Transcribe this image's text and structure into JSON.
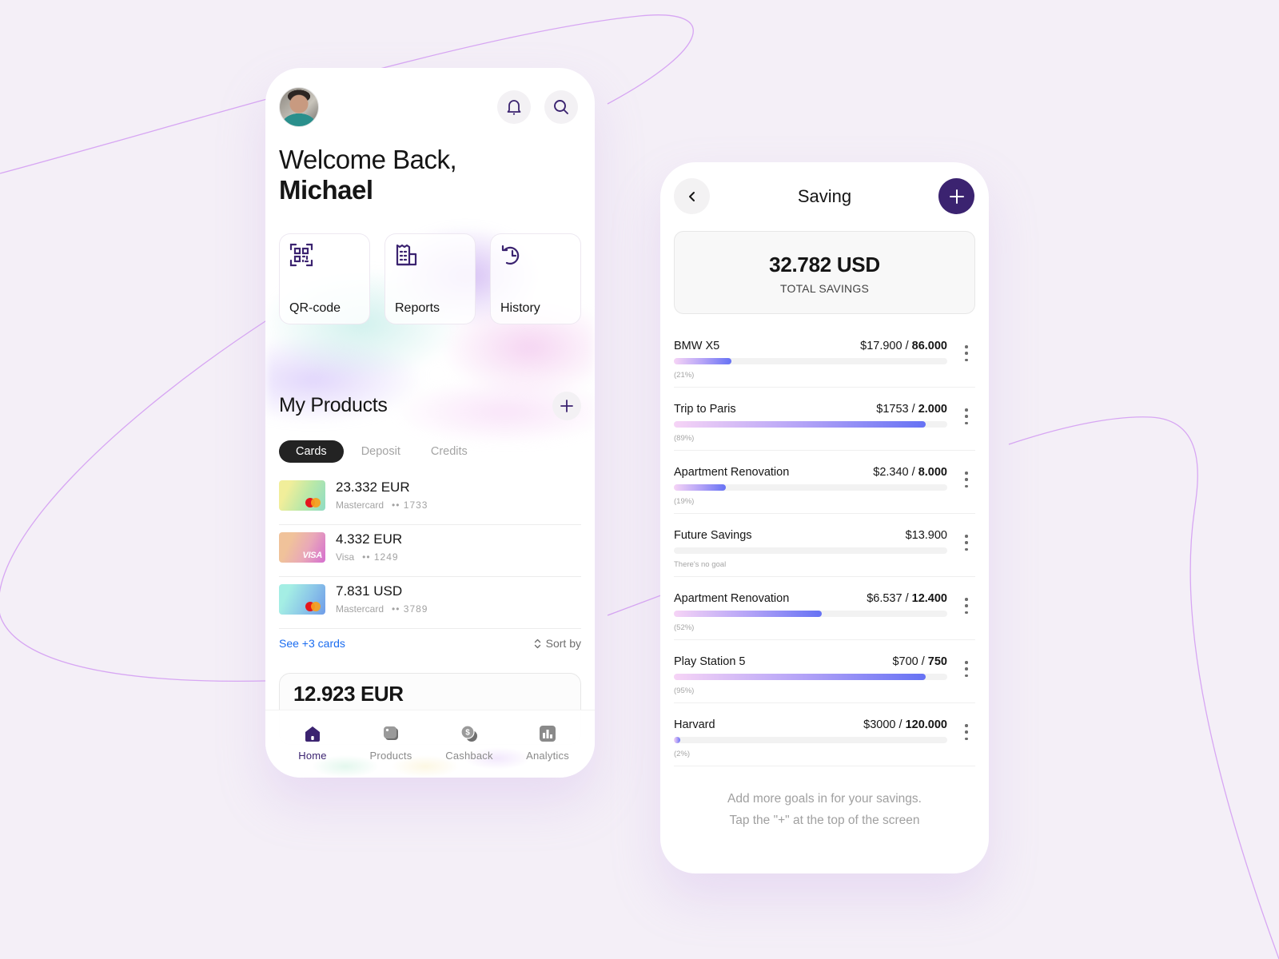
{
  "colors": {
    "background": "#f4eff7",
    "brand_purple": "#3b2370",
    "link_blue": "#1a6cf0",
    "progress_start": "#f6d4f6",
    "progress_end": "#6672f4"
  },
  "home": {
    "avatar_icon": "user-avatar-photo",
    "notifications_icon": "bell-icon",
    "search_icon": "search-icon",
    "welcome_line1": "Welcome Back,",
    "welcome_name": "Michael",
    "quick_actions": [
      {
        "label": "QR-code",
        "icon": "qr-code-icon"
      },
      {
        "label": "Reports",
        "icon": "receipt-icon"
      },
      {
        "label": "History",
        "icon": "history-icon"
      }
    ],
    "products": {
      "title": "My Products",
      "add_icon": "plus-icon",
      "tabs": [
        {
          "label": "Cards",
          "active": true
        },
        {
          "label": "Deposit",
          "active": false
        },
        {
          "label": "Credits",
          "active": false
        }
      ],
      "cards": [
        {
          "amount": "23.332 EUR",
          "brand": "Mastercard",
          "masked": "•• 1733",
          "logo": "mastercard-logo"
        },
        {
          "amount": "4.332 EUR",
          "brand": "Visa",
          "masked": "•• 1249",
          "logo": "visa-logo",
          "logo_text": "VISA"
        },
        {
          "amount": "7.831 USD",
          "brand": "Mastercard",
          "masked": "•• 3789",
          "logo": "mastercard-logo"
        }
      ],
      "see_more": "See +3 cards",
      "sort_by": "Sort by"
    },
    "balance_preview": "12.923 EUR",
    "nav": [
      {
        "label": "Home",
        "icon": "home-icon",
        "active": true
      },
      {
        "label": "Products",
        "icon": "cards-icon",
        "active": false
      },
      {
        "label": "Cashback",
        "icon": "coins-icon",
        "active": false
      },
      {
        "label": "Analytics",
        "icon": "chart-icon",
        "active": false
      }
    ]
  },
  "saving": {
    "title": "Saving",
    "back_icon": "chevron-left-icon",
    "add_icon": "plus-icon",
    "total": "32.782 USD",
    "total_label": "TOTAL SAVINGS",
    "goals": [
      {
        "name": "BMW X5",
        "saved": "$17.900",
        "target": "86.000",
        "percent_label": "(21%)",
        "progress": 0.21
      },
      {
        "name": "Trip to Paris",
        "saved": "$1753",
        "target": "2.000",
        "percent_label": "(89%)",
        "progress": 0.92
      },
      {
        "name": "Apartment Renovation",
        "saved": "$2.340",
        "target": "8.000",
        "percent_label": "(19%)",
        "progress": 0.19
      },
      {
        "name": "Future Savings",
        "saved": "$13.900",
        "target": "",
        "percent_label": "There's no goal",
        "progress": 0
      },
      {
        "name": "Apartment Renovation",
        "saved": "$6.537",
        "target": "12.400",
        "percent_label": "(52%)",
        "progress": 0.54
      },
      {
        "name": "Play Station 5",
        "saved": "$700",
        "target": "750",
        "percent_label": "(95%)",
        "progress": 0.92
      },
      {
        "name": "Harvard",
        "saved": "$3000",
        "target": "120.000",
        "percent_label": "(2%)",
        "progress": 0.02
      }
    ],
    "hint_line1": "Add more goals in for your savings.",
    "hint_line2": "Tap the \"+\" at the top of the screen"
  }
}
